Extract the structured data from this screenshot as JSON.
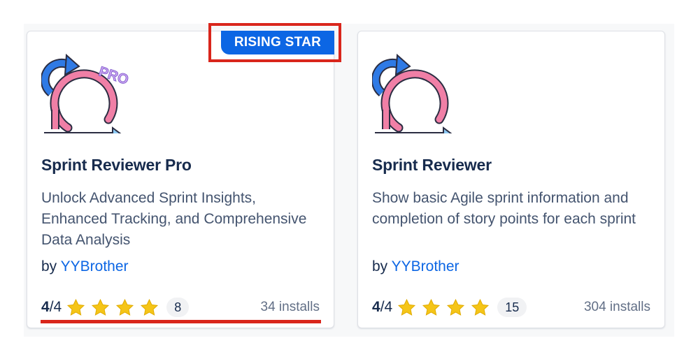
{
  "cards": [
    {
      "badge": "RISING STAR",
      "logo_icon": "sprint-cycle-arrow-icon",
      "logo_tag": "PRO",
      "title": "Sprint Reviewer Pro",
      "description": "Unlock Advanced Sprint Insights, Enhanced Tracking, and Comprehensive Data Analysis",
      "by_prefix": "by",
      "vendor": "YYBrother",
      "rating_value": "4",
      "rating_max": "/4",
      "rating_stars": 4,
      "review_count": "8",
      "installs": "34 installs"
    },
    {
      "logo_icon": "sprint-cycle-arrow-icon",
      "title": "Sprint Reviewer",
      "description": "Show basic Agile sprint information and completion of story points for each sprint",
      "by_prefix": "by",
      "vendor": "YYBrother",
      "rating_value": "4",
      "rating_max": "/4",
      "rating_stars": 4,
      "review_count": "15",
      "installs": "304 installs"
    }
  ],
  "colors": {
    "accent_blue": "#0c66e4",
    "highlight_red": "#d9261c",
    "star_yellow": "#f5c518",
    "title_text": "#172b4d",
    "body_text": "#44546f"
  }
}
